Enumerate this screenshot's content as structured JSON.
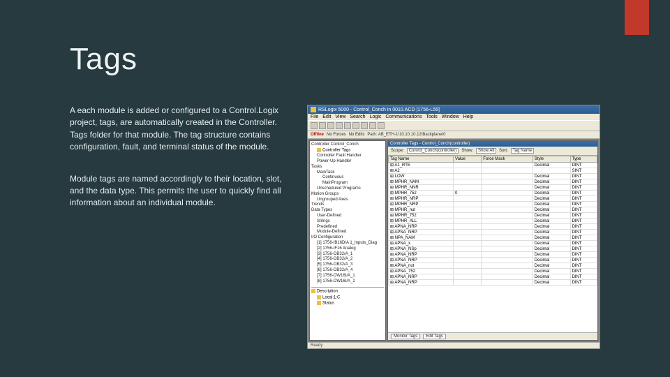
{
  "slide": {
    "title": "Tags",
    "para1": "A each module is added or configured to a Control.Logix project, tags, are automatically created in the Controller. Tags folder for that module. The tag structure contains configuration, fault, and terminal status of the module.",
    "para2": "Module tags are named accordingly to their location, slot, and the data type. This permits the user to quickly find all information about an individual module."
  },
  "app": {
    "title": "RSLogix 5000 - Control_Conch in 0010.ACD [1756-L55]",
    "menu": [
      "File",
      "Edit",
      "View",
      "Search",
      "Logic",
      "Communications",
      "Tools",
      "Window",
      "Help"
    ],
    "mode_label": "Offline",
    "no_forces": "No Forces",
    "no_edits": "No Edits",
    "path": "Path: AB_ETH-1\\10.10.10.12\\Backplane\\0",
    "tree": [
      {
        "label": "Controller Control_Conch",
        "cls": "tree-folder indent0"
      },
      {
        "label": "Controller Tags",
        "cls": "tree-item indent1"
      },
      {
        "label": "Controller Fault Handler",
        "cls": "tree-folder indent1"
      },
      {
        "label": "Power-Up Handler",
        "cls": "tree-folder indent1"
      },
      {
        "label": "Tasks",
        "cls": "tree-folder indent0"
      },
      {
        "label": "MainTask",
        "cls": "tree-folder indent1"
      },
      {
        "label": "Continuous",
        "cls": "tree-folder indent2"
      },
      {
        "label": "MainProgram",
        "cls": "tree-folder indent2"
      },
      {
        "label": "Unscheduled Programs",
        "cls": "tree-folder indent1"
      },
      {
        "label": "Motion Groups",
        "cls": "tree-folder indent0"
      },
      {
        "label": "Ungrouped Axes",
        "cls": "tree-folder indent1"
      },
      {
        "label": "Trends",
        "cls": "tree-folder indent0"
      },
      {
        "label": "Data Types",
        "cls": "tree-folder indent0"
      },
      {
        "label": "User-Defined",
        "cls": "tree-folder indent1"
      },
      {
        "label": "Strings",
        "cls": "tree-folder indent1"
      },
      {
        "label": "Predefined",
        "cls": "tree-folder indent1"
      },
      {
        "label": "Module-Defined",
        "cls": "tree-folder indent1"
      },
      {
        "label": "I/O Configuration",
        "cls": "tree-folder indent0"
      },
      {
        "label": "[1] 1756-IB16D/A 1_Inputs_Diag",
        "cls": "tree-prog indent1"
      },
      {
        "label": "[2] 1756-IF16 Analog",
        "cls": "tree-prog indent1"
      },
      {
        "label": "[3] 1756-OB32/A_1",
        "cls": "tree-prog indent1"
      },
      {
        "label": "[4] 1756-OB32/A_2",
        "cls": "tree-prog indent1"
      },
      {
        "label": "[5] 1756-OB32/A_3",
        "cls": "tree-prog indent1"
      },
      {
        "label": "[6] 1756-OB32/A_4",
        "cls": "tree-prog indent1"
      },
      {
        "label": "[7] 1756-OW16I/A_1",
        "cls": "tree-prog indent1"
      },
      {
        "label": "[8] 1756-OW16I/A_2",
        "cls": "tree-prog indent1"
      }
    ],
    "tree_bottom": [
      {
        "label": "Description",
        "cls": "tree-item indent0"
      },
      {
        "label": "Local:1:C",
        "cls": "tree-item indent1"
      },
      {
        "label": "Status",
        "cls": "tree-item indent1"
      }
    ],
    "tags_window_title": "Controller Tags - Control_Conch(controller)",
    "scope_label": "Scope:",
    "scope_value": "Control_Conch(controller)",
    "show_label": "Show:",
    "show_value": "Show All",
    "sort_label": "Sort:",
    "sort_value": "Tag Name",
    "columns": [
      "Tag Name",
      "Value",
      "Force Mask",
      "Style",
      "Type"
    ],
    "rows": [
      [
        "A1_RTE",
        "",
        "",
        "Decimal",
        "DINT"
      ],
      [
        "A2",
        "",
        "",
        "",
        "SINT"
      ],
      [
        "LOW",
        "",
        "",
        "Decimal",
        "DINT"
      ],
      [
        "MPHR_NAM",
        "",
        "",
        "Decimal",
        "DINT"
      ],
      [
        "MPHR_NNR",
        "",
        "",
        "Decimal",
        "DINT"
      ],
      [
        "MPHR_752",
        "0",
        "",
        "Decimal",
        "DINT"
      ],
      [
        "MPHR_NRP",
        "",
        "",
        "Decimal",
        "DINT"
      ],
      [
        "MPHR_NRP",
        "",
        "",
        "Decimal",
        "DINT"
      ],
      [
        "MPHR_nut",
        "",
        "",
        "Decimal",
        "DINT"
      ],
      [
        "MPHR_752",
        "",
        "",
        "Decimal",
        "DINT"
      ],
      [
        "MPHR_ALL",
        "",
        "",
        "Decimal",
        "DINT"
      ],
      [
        "APNA_NRP",
        "",
        "",
        "Decimal",
        "DINT"
      ],
      [
        "APNA_NRP",
        "",
        "",
        "Decimal",
        "DINT"
      ],
      [
        "NPA_NAM",
        "",
        "",
        "Decimal",
        "DINT"
      ],
      [
        "APNA_x",
        "",
        "",
        "Decimal",
        "DINT"
      ],
      [
        "APNA_NSp",
        "",
        "",
        "Decimal",
        "DINT"
      ],
      [
        "APNA_NRP",
        "",
        "",
        "Decimal",
        "DINT"
      ],
      [
        "APNA_NRP",
        "",
        "",
        "Decimal",
        "DINT"
      ],
      [
        "APNA_nut",
        "",
        "",
        "Decimal",
        "DINT"
      ],
      [
        "APNA_752",
        "",
        "",
        "Decimal",
        "DINT"
      ],
      [
        "APNA_NRP",
        "",
        "",
        "Decimal",
        "DINT"
      ],
      [
        "APNA_NRP",
        "",
        "",
        "Decimal",
        "DINT"
      ]
    ],
    "tabs": [
      "Monitor Tags",
      "Edit Tags"
    ],
    "status": "Ready"
  }
}
